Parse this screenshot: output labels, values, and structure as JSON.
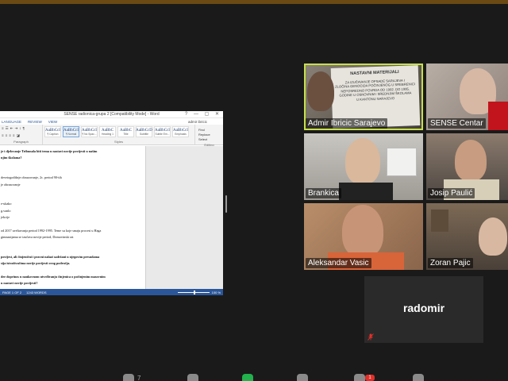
{
  "word": {
    "title": "SENSE radionica-grupa 2 [Compatibility Mode] - Word",
    "window_controls": "? — ▢ ✕",
    "menu": [
      "LANGUAGE",
      "REVIEW",
      "VIEW"
    ],
    "user": "admir ibricic",
    "groups": {
      "paragraph": "Paragraph",
      "styles": "Styles",
      "editing": "Editing"
    },
    "styles": [
      {
        "sample": "AaBbCcI",
        "name": "¶ Caption"
      },
      {
        "sample": "AaBbCcI",
        "name": "¶ Normal"
      },
      {
        "sample": "AaBbCcI",
        "name": "¶ No Spac..."
      },
      {
        "sample": "AaBbC",
        "name": "Heading 1"
      },
      {
        "sample": "AaBbC",
        "name": "Title"
      },
      {
        "sample": "AaBbCcD",
        "name": "Subtitle"
      },
      {
        "sample": "AaBbCcI",
        "name": "Subtle Em..."
      },
      {
        "sample": "AaBbCcI",
        "name": "Emphasis"
      }
    ],
    "editing": [
      "Find",
      "Replace",
      "Select"
    ],
    "doc_lines": [
      {
        "text": "je i djelovanje Tribunala biti tema u nastavi novije povijesti u našim",
        "bold": true
      },
      {
        "text": "njim školama?",
        "bold": true
      },
      {
        "text": "",
        "bold": false
      },
      {
        "text": "",
        "bold": false
      },
      {
        "text": "devetogodišnje obrazovanje, 2c. period 90-tih",
        "bold": false
      },
      {
        "text": "je obrazovanje",
        "bold": false
      },
      {
        "text": "",
        "bold": false
      },
      {
        "text": "",
        "bold": false
      },
      {
        "text": "e-ukako",
        "bold": false
      },
      {
        "text": "g.vanlo",
        "bold": false
      },
      {
        "text": "jekcije",
        "bold": false
      },
      {
        "text": "",
        "bold": false
      },
      {
        "text": "od 2017 uvrštavanja period 1992-1995. Teme su koje smaju procesi u Haga",
        "bold": false
      },
      {
        "text": "gimnazijama se izučava novije period, Domovinski rat",
        "bold": false
      },
      {
        "text": "",
        "bold": false
      },
      {
        "text": "",
        "bold": false
      },
      {
        "text": "povijest, ali činjenični i pravni nalazi sadržani u njegovim presudama",
        "bold": true
      },
      {
        "text": "sija istraživačima novije povijesti ovog područja.",
        "bold": true
      },
      {
        "text": "",
        "bold": false
      },
      {
        "text": "dee doprinos u naukovnom utvrđivanju činjenica o počinjenim masovnim",
        "bold": true
      },
      {
        "text": "u nastavi novije povijesti?",
        "bold": true
      }
    ],
    "status": {
      "page": "PAGE 1 OF 2",
      "words": "1243 WORDS",
      "zoom": "100 %"
    }
  },
  "participants": [
    {
      "name": "Admir Ibricic Sarajevo",
      "active": true
    },
    {
      "name": "SENSE Centar",
      "active": false
    },
    {
      "name": "Brankica",
      "active": false
    },
    {
      "name": "Josip Paulić",
      "active": false
    },
    {
      "name": "Aleksandar Vasic",
      "active": false
    },
    {
      "name": "Zoran Pajic",
      "active": false
    }
  ],
  "poster": {
    "title": "NASTAVNI MATERIJALI",
    "lines": [
      "ZA IZUČAVANJE OPSADE SARAJEVA I",
      "ZLOČINA GENOCIDA POČINJENOG U SREBRENICI",
      "NEPOSREDNO POVRDA OD 1992. DO 1995.",
      "GODINE U OSNOVNIM I SREDNJIM ŠKOLAMA",
      "U KANTONU SARAJEVO"
    ]
  },
  "audio_only": {
    "name": "radomir",
    "muted": true
  },
  "toolbar": {
    "participants_count": "7",
    "chat_badge": "1"
  },
  "colors": {
    "active_border": "#c7e04a",
    "word_blue": "#2b579a",
    "mute_red": "#e0302a",
    "share_green": "#22b14c"
  }
}
